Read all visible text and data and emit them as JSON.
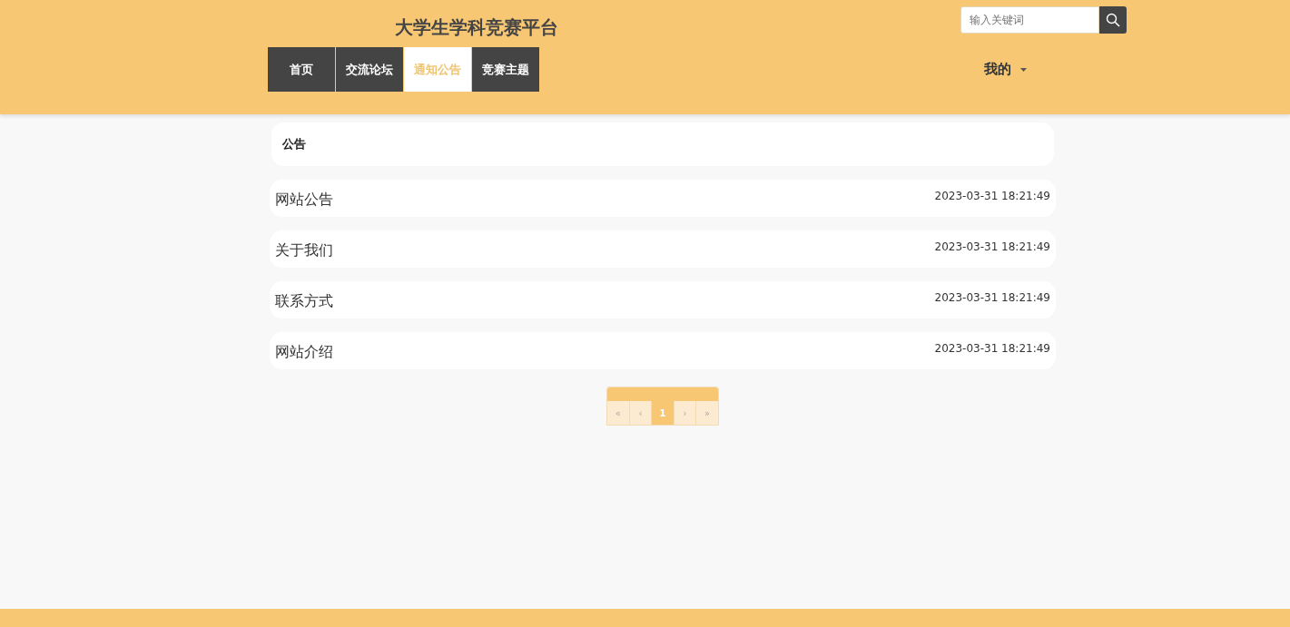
{
  "site_title": "大学生学科竞赛平台",
  "search": {
    "placeholder": "输入关键词"
  },
  "nav": [
    {
      "label": "首页",
      "selected": false
    },
    {
      "label": "交流论坛",
      "selected": false
    },
    {
      "label": "通知公告",
      "selected": true
    },
    {
      "label": "竞赛主题",
      "selected": false
    }
  ],
  "user_menu": {
    "label": "我的"
  },
  "section_title": "公告",
  "notices": [
    {
      "title": "网站公告",
      "time": "2023-03-31 18:21:49"
    },
    {
      "title": "关于我们",
      "time": "2023-03-31 18:21:49"
    },
    {
      "title": "联系方式",
      "time": "2023-03-31 18:21:49"
    },
    {
      "title": "网站介绍",
      "time": "2023-03-31 18:21:49"
    }
  ],
  "pagination": [
    {
      "label": "«",
      "selected": false
    },
    {
      "label": "‹",
      "selected": false
    },
    {
      "label": "1",
      "selected": true
    },
    {
      "label": "›",
      "selected": false
    },
    {
      "label": "»",
      "selected": false
    }
  ]
}
